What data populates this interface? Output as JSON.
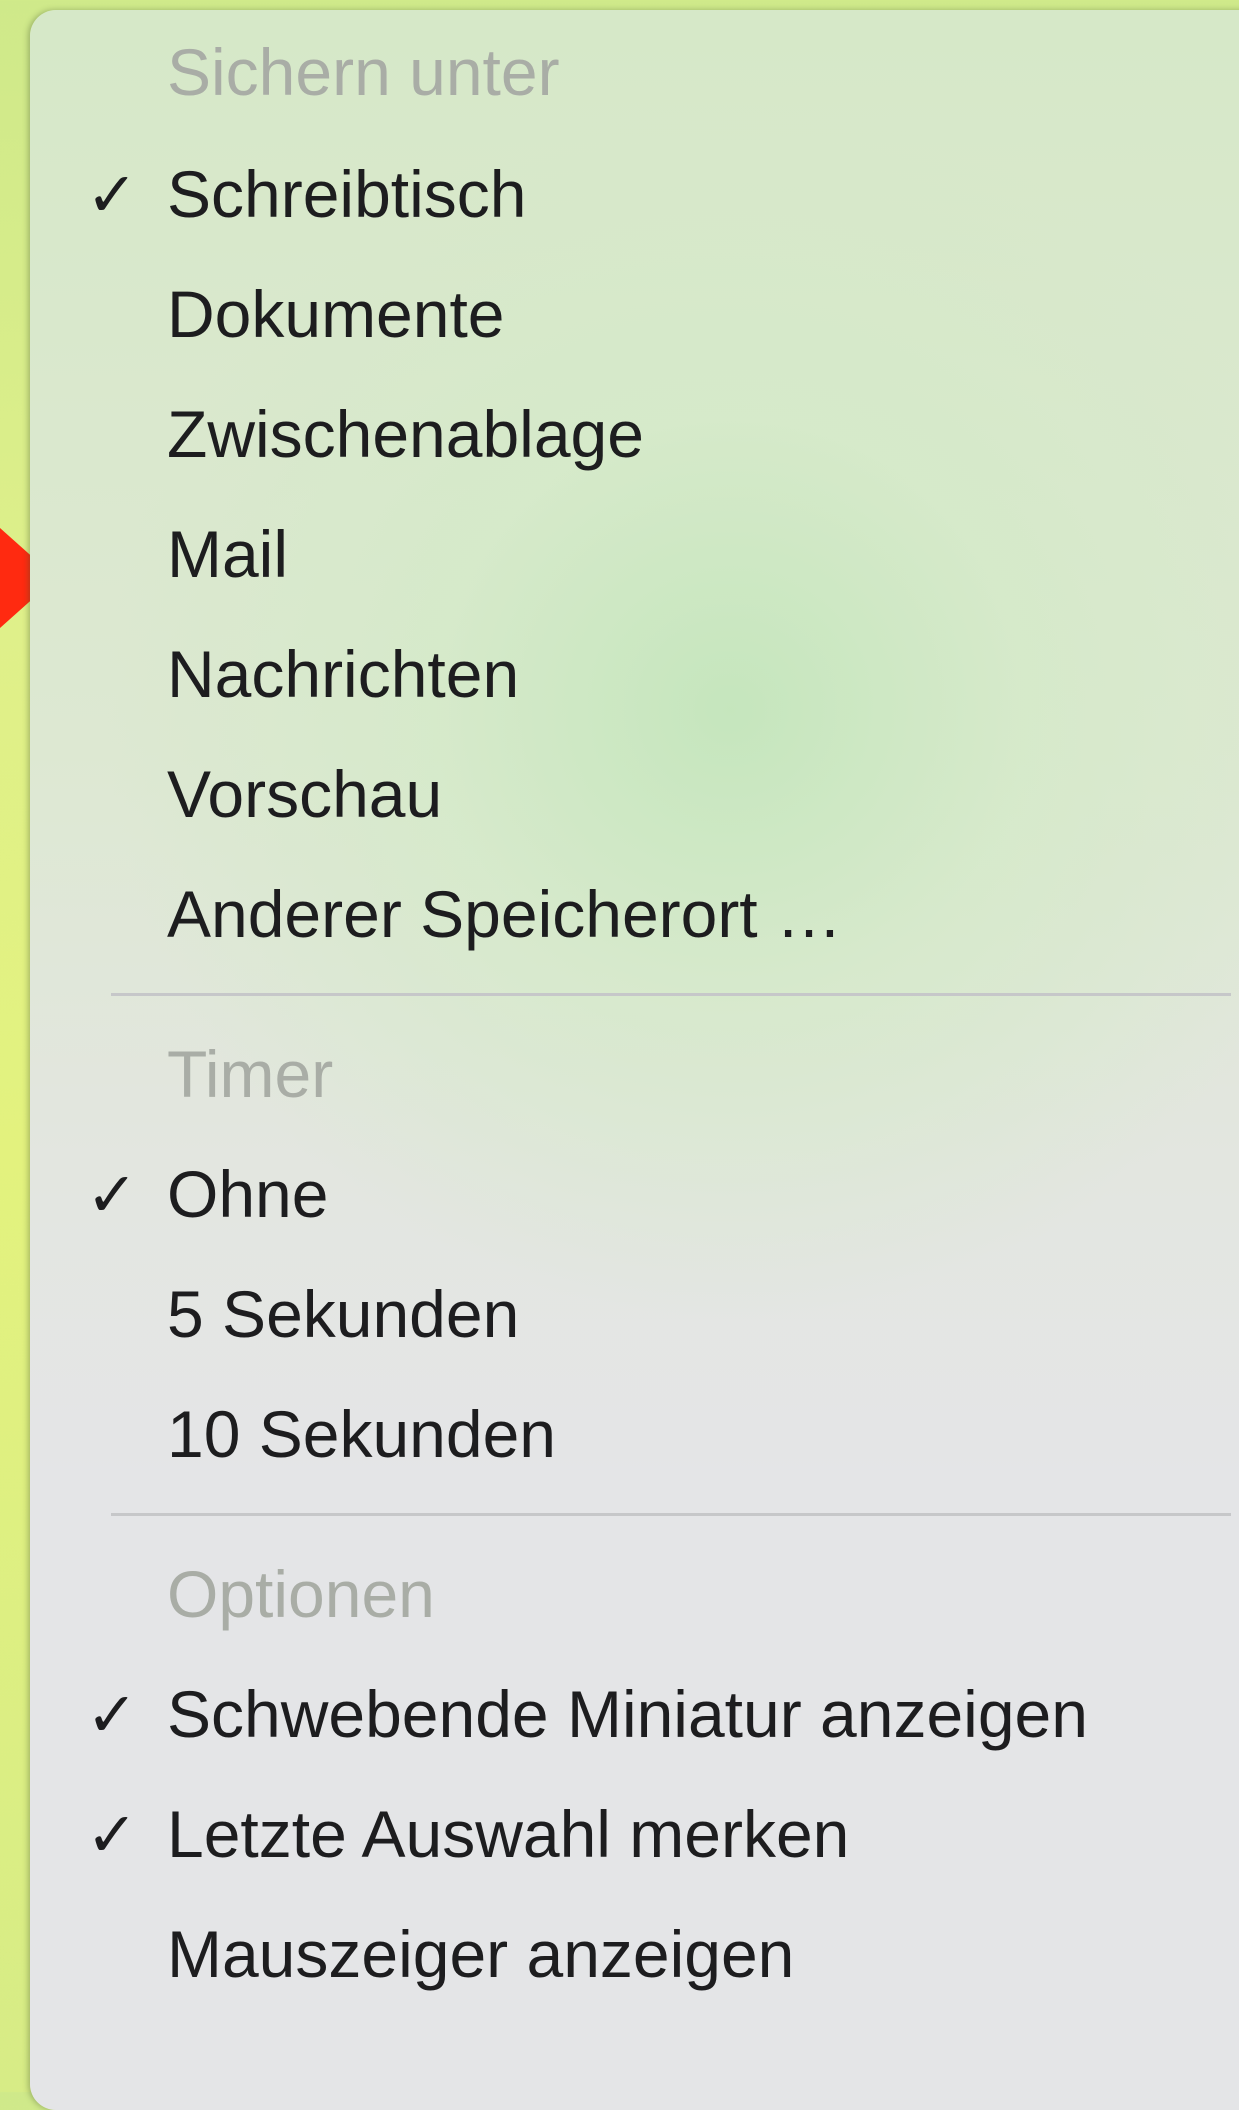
{
  "menu": {
    "sections": [
      {
        "header": "Sichern unter",
        "items": [
          {
            "label": "Schreibtisch",
            "checked": true
          },
          {
            "label": "Dokumente",
            "checked": false
          },
          {
            "label": "Zwischenablage",
            "checked": false
          },
          {
            "label": "Mail",
            "checked": false
          },
          {
            "label": "Nachrichten",
            "checked": false
          },
          {
            "label": "Vorschau",
            "checked": false
          },
          {
            "label": "Anderer Speicherort …",
            "checked": false
          }
        ]
      },
      {
        "header": "Timer",
        "items": [
          {
            "label": "Ohne",
            "checked": true
          },
          {
            "label": "5 Sekunden",
            "checked": false
          },
          {
            "label": "10 Sekunden",
            "checked": false
          }
        ]
      },
      {
        "header": "Optionen",
        "items": [
          {
            "label": "Schwebende Miniatur anzeigen",
            "checked": true
          },
          {
            "label": "Letzte Auswahl merken",
            "checked": true
          },
          {
            "label": "Mauszeiger anzeigen",
            "checked": false
          }
        ]
      }
    ],
    "check_glyph": "✓"
  },
  "colors": {
    "background_accent": "#e3f27e",
    "arrow": "#ff2a10",
    "text": "#1d1d1f",
    "header_text": "#a9ada6"
  }
}
